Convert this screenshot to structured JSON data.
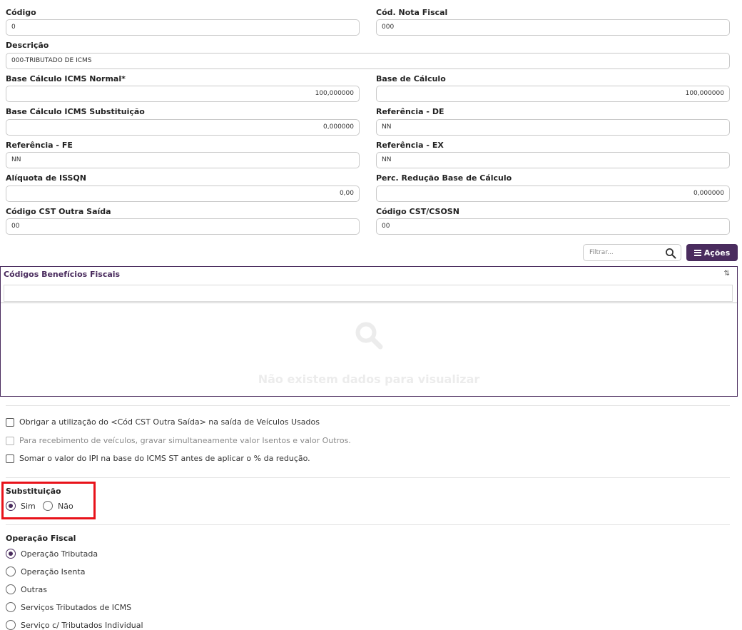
{
  "fields": {
    "codigo": {
      "label": "Código",
      "value": "0"
    },
    "cod_nota_fiscal": {
      "label": "Cód. Nota Fiscal",
      "value": "000"
    },
    "descricao": {
      "label": "Descrição",
      "value": "000-TRIBUTADO DE ICMS"
    },
    "base_calc_icms_normal": {
      "label": "Base Cálculo ICMS Normal*",
      "value": "100,000000"
    },
    "base_de_calculo": {
      "label": "Base de Cálculo",
      "value": "100,000000"
    },
    "base_calc_icms_subst": {
      "label": "Base Cálculo ICMS Substituição",
      "value": "0,000000"
    },
    "referencia_de": {
      "label": "Referência - DE",
      "value": "NN"
    },
    "referencia_fe": {
      "label": "Referência - FE",
      "value": "NN"
    },
    "referencia_ex": {
      "label": "Referência - EX",
      "value": "NN"
    },
    "aliquota_issqn": {
      "label": "Alíquota de ISSQN",
      "value": "0,00"
    },
    "perc_reducao": {
      "label": "Perc. Redução Base de Cálculo",
      "value": "0,000000"
    },
    "cst_outra_saida": {
      "label": "Código CST Outra Saída",
      "value": "00"
    },
    "cst_csosn": {
      "label": "Código CST/CSOSN",
      "value": "00"
    }
  },
  "toolbar": {
    "filter_placeholder": "Filtrar...",
    "acoes_label": "Ações"
  },
  "grid": {
    "title": "Códigos Benefícios Fiscais",
    "sort_glyph": "⇅",
    "empty_text": "Não existem dados para visualizar"
  },
  "checkboxes": [
    {
      "label": "Obrigar a utilização do <Cód CST Outra Saída> na saída de Veículos Usados",
      "checked": false,
      "disabled": false
    },
    {
      "label": "Para recebimento de veículos, gravar simultaneamente valor Isentos e valor Outros.",
      "checked": false,
      "disabled": true
    },
    {
      "label": "Somar o valor do IPI na base do ICMS ST antes de aplicar o % da redução.",
      "checked": false,
      "disabled": false
    }
  ],
  "substituicao": {
    "label": "Substituição",
    "options": [
      "Sim",
      "Não"
    ],
    "selected": "Sim"
  },
  "operacao_fiscal": {
    "label": "Operação Fiscal",
    "options": [
      "Operação Tributada",
      "Operação Isenta",
      "Outras",
      "Serviços Tributados de ICMS",
      "Serviço c/ Tributados Individual"
    ],
    "selected": "Operação Tributada"
  },
  "colors": {
    "accent": "#4a2c5e",
    "highlight_border": "#e8121a"
  }
}
